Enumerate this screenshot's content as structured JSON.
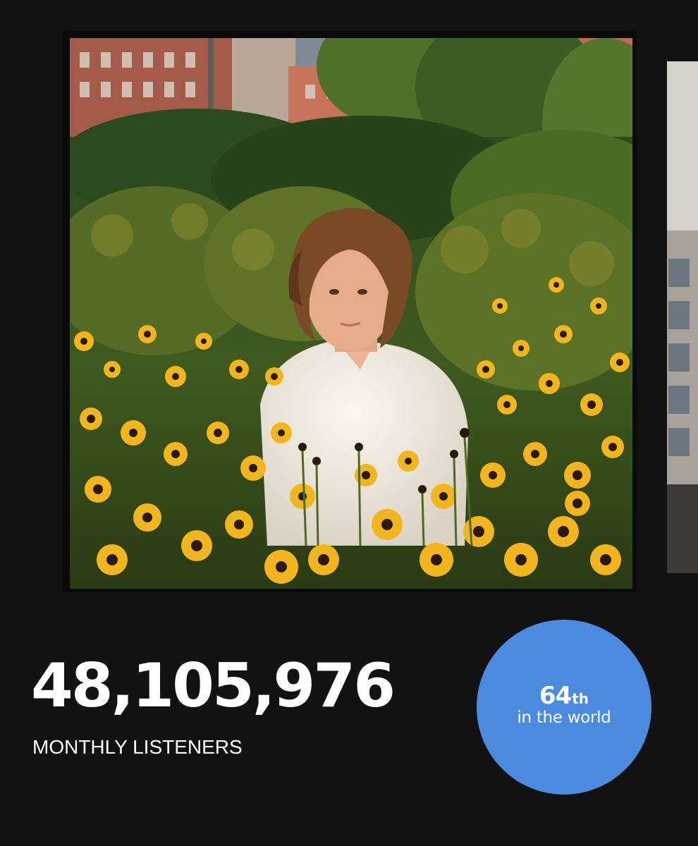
{
  "stats": {
    "monthly_listeners": "48,105,976",
    "monthly_listeners_label": "MONTHLY LISTENERS",
    "world_rank": "64",
    "world_rank_suffix": "th",
    "world_rank_caption": "in the world"
  },
  "colors": {
    "background": "#121212",
    "rank_badge": "#4a8adf",
    "text": "#ffffff"
  }
}
